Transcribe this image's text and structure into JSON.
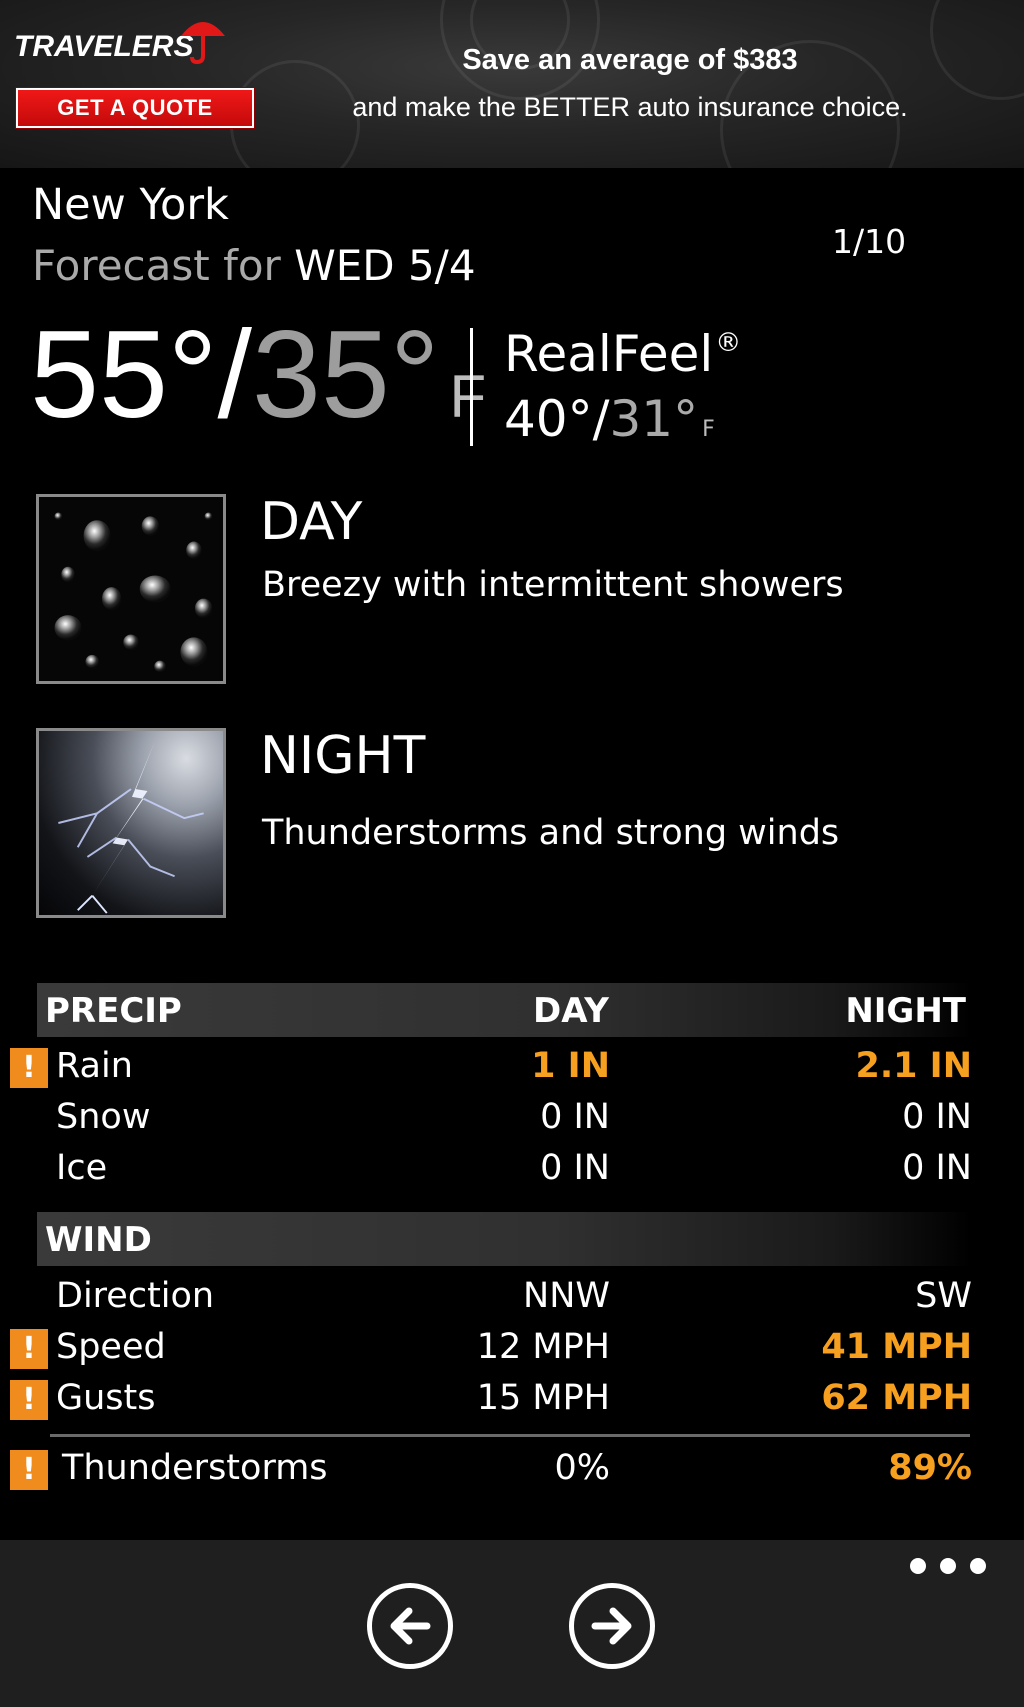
{
  "ad": {
    "brand": "TRAVELERS",
    "quote_button": "GET A QUOTE",
    "line1": "Save an average of $383",
    "line2": "and make the BETTER auto insurance choice."
  },
  "header": {
    "city": "New York",
    "forecast_prefix": "Forecast for",
    "date": "WED 5/4",
    "page_count": "1/10"
  },
  "temps": {
    "high": "55°",
    "separator": "/",
    "low": "35°",
    "unit": "F",
    "realfeel_label": "RealFeel",
    "realfeel_mark": "®",
    "realfeel_high": "40°",
    "realfeel_low": "31°",
    "realfeel_unit": "F"
  },
  "day": {
    "title": "DAY",
    "description": "Breezy with intermittent showers",
    "icon": "raindrops-image"
  },
  "night": {
    "title": "NIGHT",
    "description": "Thunderstorms and strong winds",
    "icon": "lightning-image"
  },
  "precip": {
    "header": "PRECIP",
    "col_day": "DAY",
    "col_night": "NIGHT",
    "rows": [
      {
        "label": "Rain",
        "day": "1 IN",
        "night": "2.1 IN",
        "alert": true
      },
      {
        "label": "Snow",
        "day": "0 IN",
        "night": "0 IN",
        "alert": false
      },
      {
        "label": "Ice",
        "day": "0 IN",
        "night": "0 IN",
        "alert": false
      }
    ]
  },
  "wind": {
    "header": "WIND",
    "rows": [
      {
        "label": "Direction",
        "day": "NNW",
        "night": "SW",
        "alert": false
      },
      {
        "label": "Speed",
        "day": "12 MPH",
        "night": "41 MPH",
        "alert": true
      },
      {
        "label": "Gusts",
        "day": "15 MPH",
        "night": "62 MPH",
        "alert": true
      }
    ]
  },
  "thunder": {
    "label": "Thunderstorms",
    "day": "0%",
    "night": "89%",
    "alert": true
  },
  "warning_glyph": "!",
  "colors": {
    "alert": "#f7a020",
    "warning_badge": "#f08c1e",
    "ad_button": "#e01010",
    "background": "#000000",
    "appbar": "#1f1f1f"
  },
  "appbar": {
    "more_icon": "ellipsis-icon",
    "back_icon": "arrow-left-icon",
    "forward_icon": "arrow-right-icon"
  }
}
